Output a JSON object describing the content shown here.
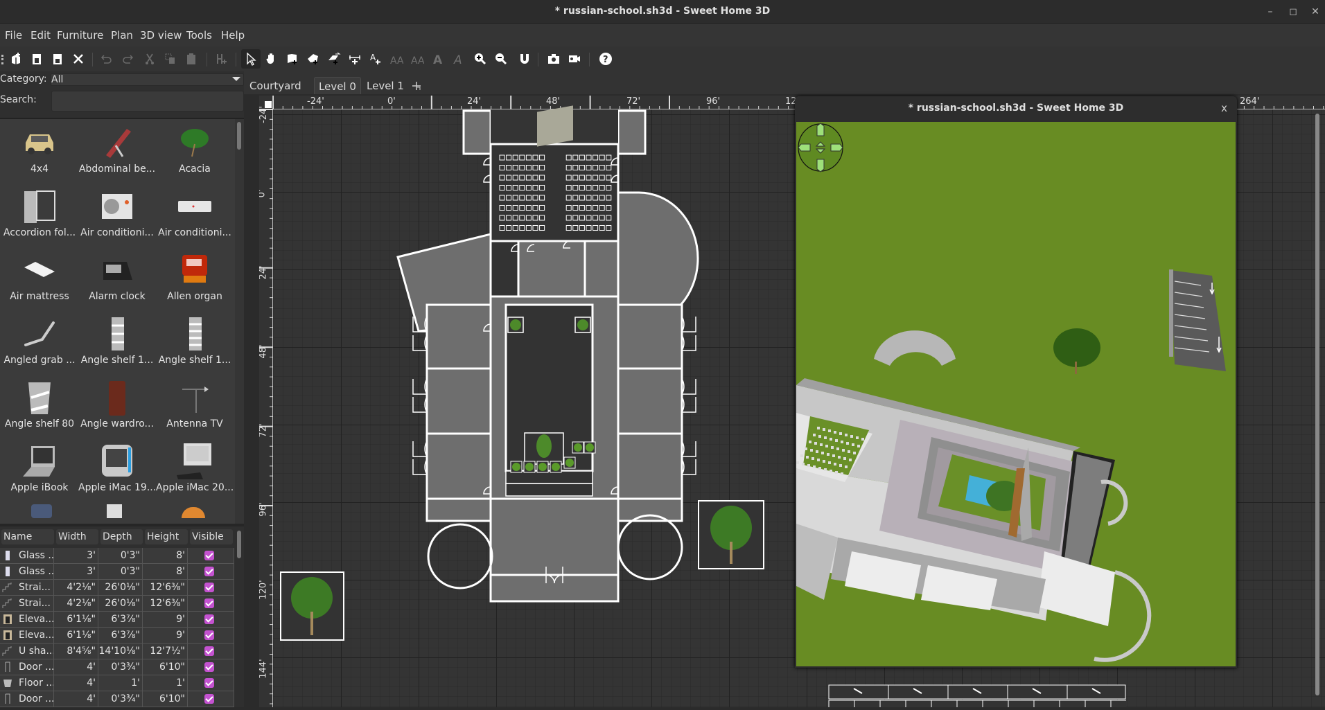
{
  "window": {
    "title": "* russian-school.sh3d - Sweet Home 3D",
    "controls": {
      "minimize": "–",
      "maximize": "◻",
      "close": "✕"
    }
  },
  "menubar": [
    "File",
    "Edit",
    "Furniture",
    "Plan",
    "3D view",
    "Tools",
    "Help"
  ],
  "toolbar": {
    "buttons": [
      "new-home",
      "open",
      "save",
      "cut-preferences",
      "undo",
      "redo",
      "cut",
      "copy",
      "paste",
      "add-furniture",
      "select-mode",
      "pan-mode",
      "create-walls",
      "create-rooms",
      "create-polylines",
      "create-dimensions",
      "add-text",
      "increase-text-size",
      "decrease-text-size",
      "bold-text",
      "italic-text",
      "zoom-in",
      "zoom-out",
      "magnetism",
      "create-photo",
      "create-video",
      "help"
    ],
    "selected": "select-mode"
  },
  "catalog": {
    "category_label": "Category:",
    "category_value": "All",
    "search_label": "Search:",
    "search_value": "",
    "items": [
      {
        "label": "4x4",
        "icon": "car-icon"
      },
      {
        "label": "Abdominal be...",
        "icon": "exercise-bench-icon"
      },
      {
        "label": "Acacia",
        "icon": "tree-icon"
      },
      {
        "label": "Accordion fol...",
        "icon": "folding-door-icon"
      },
      {
        "label": "Air conditioni...",
        "icon": "ac-outdoor-unit-icon"
      },
      {
        "label": "Air conditioni...",
        "icon": "ac-indoor-unit-icon"
      },
      {
        "label": "Air mattress",
        "icon": "mattress-icon"
      },
      {
        "label": "Alarm clock",
        "icon": "alarm-clock-icon"
      },
      {
        "label": "Allen organ",
        "icon": "organ-icon"
      },
      {
        "label": "Angled grab ...",
        "icon": "grab-bar-icon"
      },
      {
        "label": "Angle shelf 1...",
        "icon": "angle-shelf-icon"
      },
      {
        "label": "Angle shelf 1...",
        "icon": "angle-shelf-icon"
      },
      {
        "label": "Angle shelf 80",
        "icon": "angle-shelf-icon"
      },
      {
        "label": "Angle wardro...",
        "icon": "wardrobe-icon"
      },
      {
        "label": "Antenna TV",
        "icon": "antenna-icon"
      },
      {
        "label": "Apple iBook",
        "icon": "laptop-icon"
      },
      {
        "label": "Apple iMac 19...",
        "icon": "imac-icon"
      },
      {
        "label": "Apple iMac 20...",
        "icon": "desktop-computer-icon"
      }
    ]
  },
  "furniture_table": {
    "columns": [
      "Name",
      "Width",
      "Depth",
      "Height",
      "Visible"
    ],
    "rows": [
      {
        "name": "Glass ...",
        "width": "3'",
        "depth": "0'3\"",
        "height": "8'",
        "visible": true,
        "icon": "glass-door-icon"
      },
      {
        "name": "Glass ...",
        "width": "3'",
        "depth": "0'3\"",
        "height": "8'",
        "visible": true,
        "icon": "glass-door-icon"
      },
      {
        "name": "Strai...",
        "width": "4'2⅛\"",
        "depth": "26'0⅛\"",
        "height": "12'6⅜\"",
        "visible": true,
        "icon": "staircase-icon"
      },
      {
        "name": "Strai...",
        "width": "4'2⅛\"",
        "depth": "26'0⅛\"",
        "height": "12'6⅜\"",
        "visible": true,
        "icon": "staircase-icon"
      },
      {
        "name": "Eleva...",
        "width": "6'1⅛\"",
        "depth": "6'3⅞\"",
        "height": "9'",
        "visible": true,
        "icon": "elevator-icon"
      },
      {
        "name": "Eleva...",
        "width": "6'1⅛\"",
        "depth": "6'3⅞\"",
        "height": "9'",
        "visible": true,
        "icon": "elevator-icon"
      },
      {
        "name": "U sha...",
        "width": "8'4⅝\"",
        "depth": "14'10⅛\"",
        "height": "12'7½\"",
        "visible": true,
        "icon": "staircase-icon"
      },
      {
        "name": "Door ...",
        "width": "4'",
        "depth": "0'3¾\"",
        "height": "6'10\"",
        "visible": true,
        "icon": "door-icon"
      },
      {
        "name": "Floor ...",
        "width": "4'",
        "depth": "1'",
        "height": "1'",
        "visible": true,
        "icon": "floor-block-icon"
      },
      {
        "name": "Door ...",
        "width": "4'",
        "depth": "0'3¾\"",
        "height": "6'10\"",
        "visible": true,
        "icon": "door-icon"
      }
    ]
  },
  "plan": {
    "level_tabs": [
      "Courtyard",
      "Level 0",
      "Level 1"
    ],
    "active_level": "Level 0",
    "add_level_icon": "add-level-icon",
    "ruler_h": [
      "-24'",
      "0'",
      "24'",
      "48'",
      "72'",
      "96'",
      "12",
      "264'"
    ],
    "ruler_v": [
      "-24'",
      "0'",
      "24'",
      "48'",
      "72'",
      "96'",
      "120'",
      "144'"
    ]
  },
  "view3d": {
    "title": "* russian-school.sh3d - Sweet Home 3D",
    "close": "x",
    "ground_color": "#688c23"
  }
}
